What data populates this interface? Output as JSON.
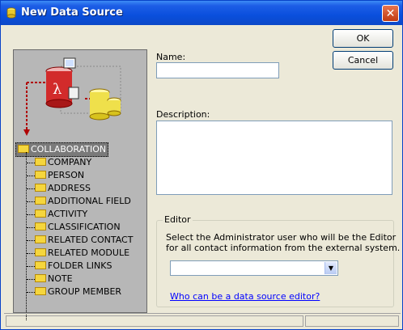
{
  "window": {
    "title": "New Data Source",
    "close_symbol": "✕"
  },
  "buttons": {
    "ok": "OK",
    "cancel": "Cancel"
  },
  "form": {
    "name_label": "Name:",
    "name_value": "",
    "description_label": "Description:",
    "description_value": ""
  },
  "editor_group": {
    "title": "Editor",
    "instructions_line1": "Select the Administrator user who will be the Editor",
    "instructions_line2": "for all contact information from the external system.",
    "selected_editor": "",
    "help_link": "Who can be a data source editor?"
  },
  "tree": {
    "root": "COLLABORATION",
    "items": [
      "COMPANY",
      "PERSON",
      "ADDRESS",
      "ADDITIONAL FIELD",
      "ACTIVITY",
      "CLASSIFICATION",
      "RELATED CONTACT",
      "RELATED MODULE",
      "FOLDER LINKS",
      "NOTE",
      "GROUP MEMBER"
    ]
  }
}
